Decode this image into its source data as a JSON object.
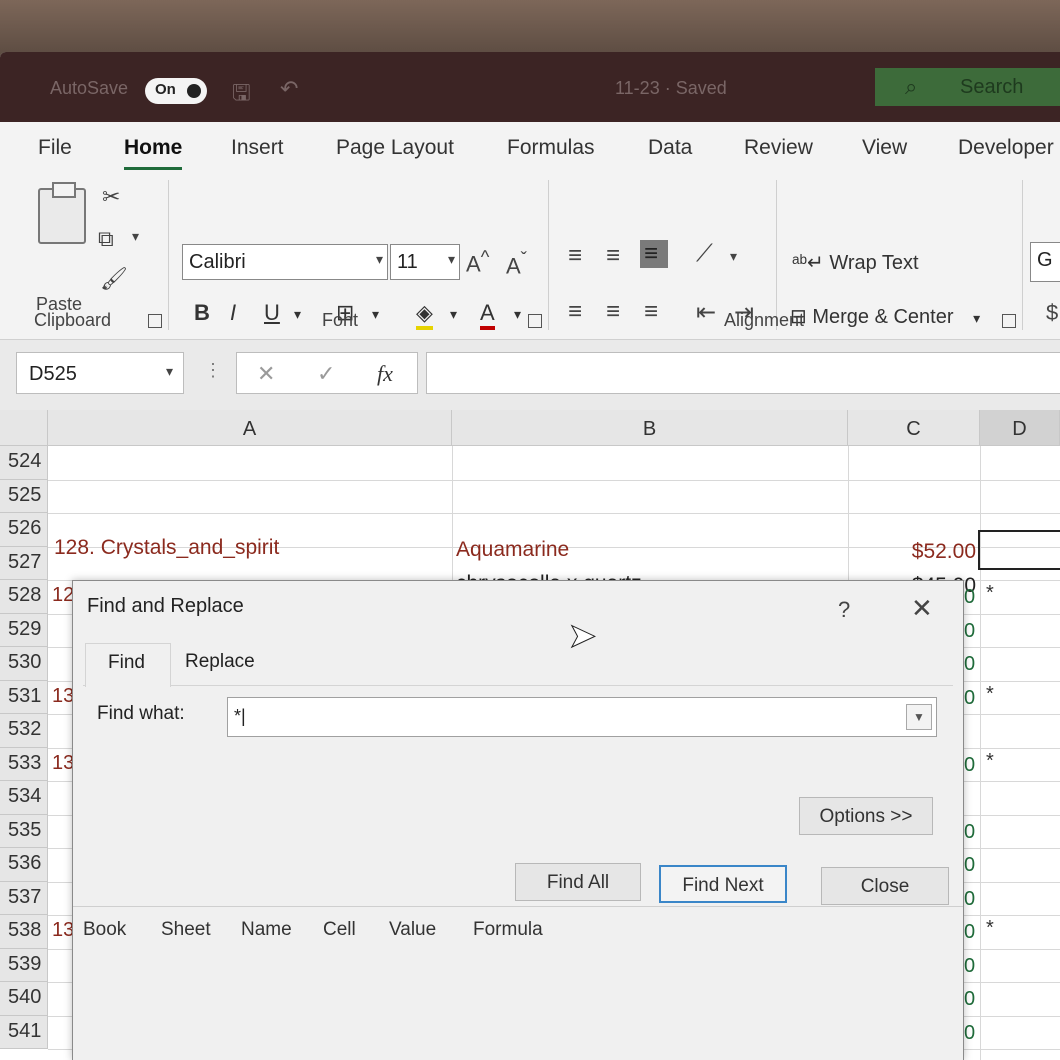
{
  "titlebar": {
    "autosave_label": "AutoSave",
    "autosave_state": "On",
    "document_title": "11-23 · Saved",
    "search_label": "Search"
  },
  "tabs": [
    "File",
    "Home",
    "Insert",
    "Page Layout",
    "Formulas",
    "Data",
    "Review",
    "View",
    "Developer"
  ],
  "ribbon": {
    "clipboard": {
      "paste_label": "Paste",
      "group_label": "Clipboard"
    },
    "font": {
      "font_name": "Calibri",
      "font_size": "11",
      "bold": "B",
      "italic": "I",
      "underline": "U",
      "group_label": "Font"
    },
    "alignment": {
      "wrap_text": "Wrap Text",
      "merge_center": "Merge & Center",
      "group_label": "Alignment"
    },
    "number_partial": "G"
  },
  "formula_bar": {
    "name_box": "D525",
    "cancel": "✕",
    "enter": "✓",
    "fx": "fx",
    "content": ""
  },
  "grid": {
    "columns": [
      "A",
      "B",
      "C",
      "D"
    ],
    "rows": [
      "524",
      "525",
      "526",
      "527",
      "528",
      "529",
      "530",
      "531",
      "532",
      "533",
      "534",
      "535",
      "536",
      "537",
      "538",
      "539",
      "540",
      "541"
    ],
    "cells": {
      "A525": "128. Crystals_and_spirit",
      "B525": "Aquamarine",
      "C525": "$52.00",
      "B526": "chrysocolla x quartz",
      "C526": "$45.00"
    },
    "edge_a": {
      "528": "12",
      "531": "13",
      "533": "13",
      "538": "13"
    },
    "edge_c": "0",
    "star": "*"
  },
  "dialog": {
    "title": "Find and Replace",
    "help": "?",
    "close": "✕",
    "tab_find": "Find",
    "tab_replace": "Replace",
    "find_what_label": "Find what:",
    "find_what_value": "*|",
    "options_button": "Options >>",
    "find_all_button": "Find All",
    "find_next_button": "Find Next",
    "close_button": "Close",
    "results_columns": [
      "Book",
      "Sheet",
      "Name",
      "Cell",
      "Value",
      "Formula"
    ]
  },
  "colors": {
    "excel_green": "#1f6b3a",
    "title_bg": "#3c2424",
    "red_text": "#8b2a1e",
    "focus_blue": "#3a86c8"
  }
}
